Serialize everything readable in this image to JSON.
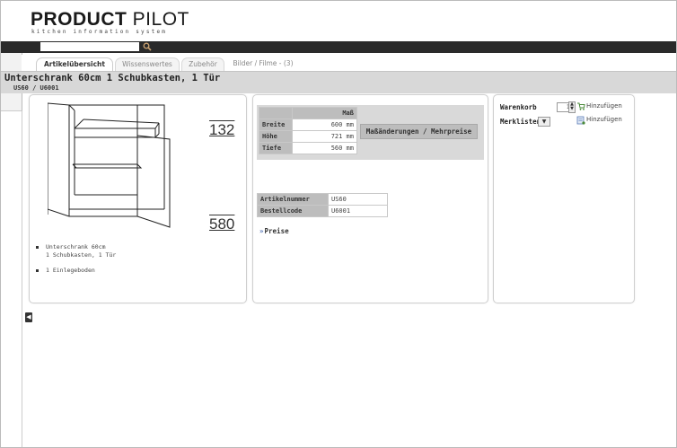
{
  "brand": {
    "name_bold": "PRODUCT",
    "name_light": " PILOT",
    "tagline": "kitchen information system"
  },
  "search": {
    "value": ""
  },
  "tabs": [
    {
      "label": "Artikelübersicht",
      "active": true
    },
    {
      "label": "Wissenswertes",
      "active": false
    },
    {
      "label": "Zubehör",
      "active": false
    },
    {
      "label": "Bilder / Filme - (3)",
      "active": false
    }
  ],
  "product": {
    "title": "Unterschrank 60cm 1 Schubkasten, 1 Tür",
    "subtitle": "US60 / U6001",
    "measure_top": "132",
    "measure_bottom": "580",
    "bullets": [
      "Unterschrank 60cm\n1 Schubkasten, 1 Tür",
      "1 Einlegeboden"
    ]
  },
  "dimensions": {
    "header": "Maß",
    "rows": [
      {
        "label": "Breite",
        "value": "600 mm"
      },
      {
        "label": "Höhe",
        "value": "721 mm"
      },
      {
        "label": "Tiefe",
        "value": "560 mm"
      }
    ],
    "button_label": "Maßänderungen / Mehrpreise"
  },
  "identifiers": {
    "rows": [
      {
        "label": "Artikelnummer",
        "value": "US60"
      },
      {
        "label": "Bestellcode",
        "value": "U6001"
      }
    ]
  },
  "prices_link": "Preise",
  "cart": {
    "warenkorb_label": "Warenkorb",
    "quantity": "1",
    "merklisten_label": "Merklisten",
    "add_label": "Hinzufügen",
    "add_label_2": "Hinzufügen"
  },
  "colors": {
    "topbar": "#2a2a2a",
    "title_band": "#d8d8d8",
    "table_label": "#bdbdbd"
  }
}
